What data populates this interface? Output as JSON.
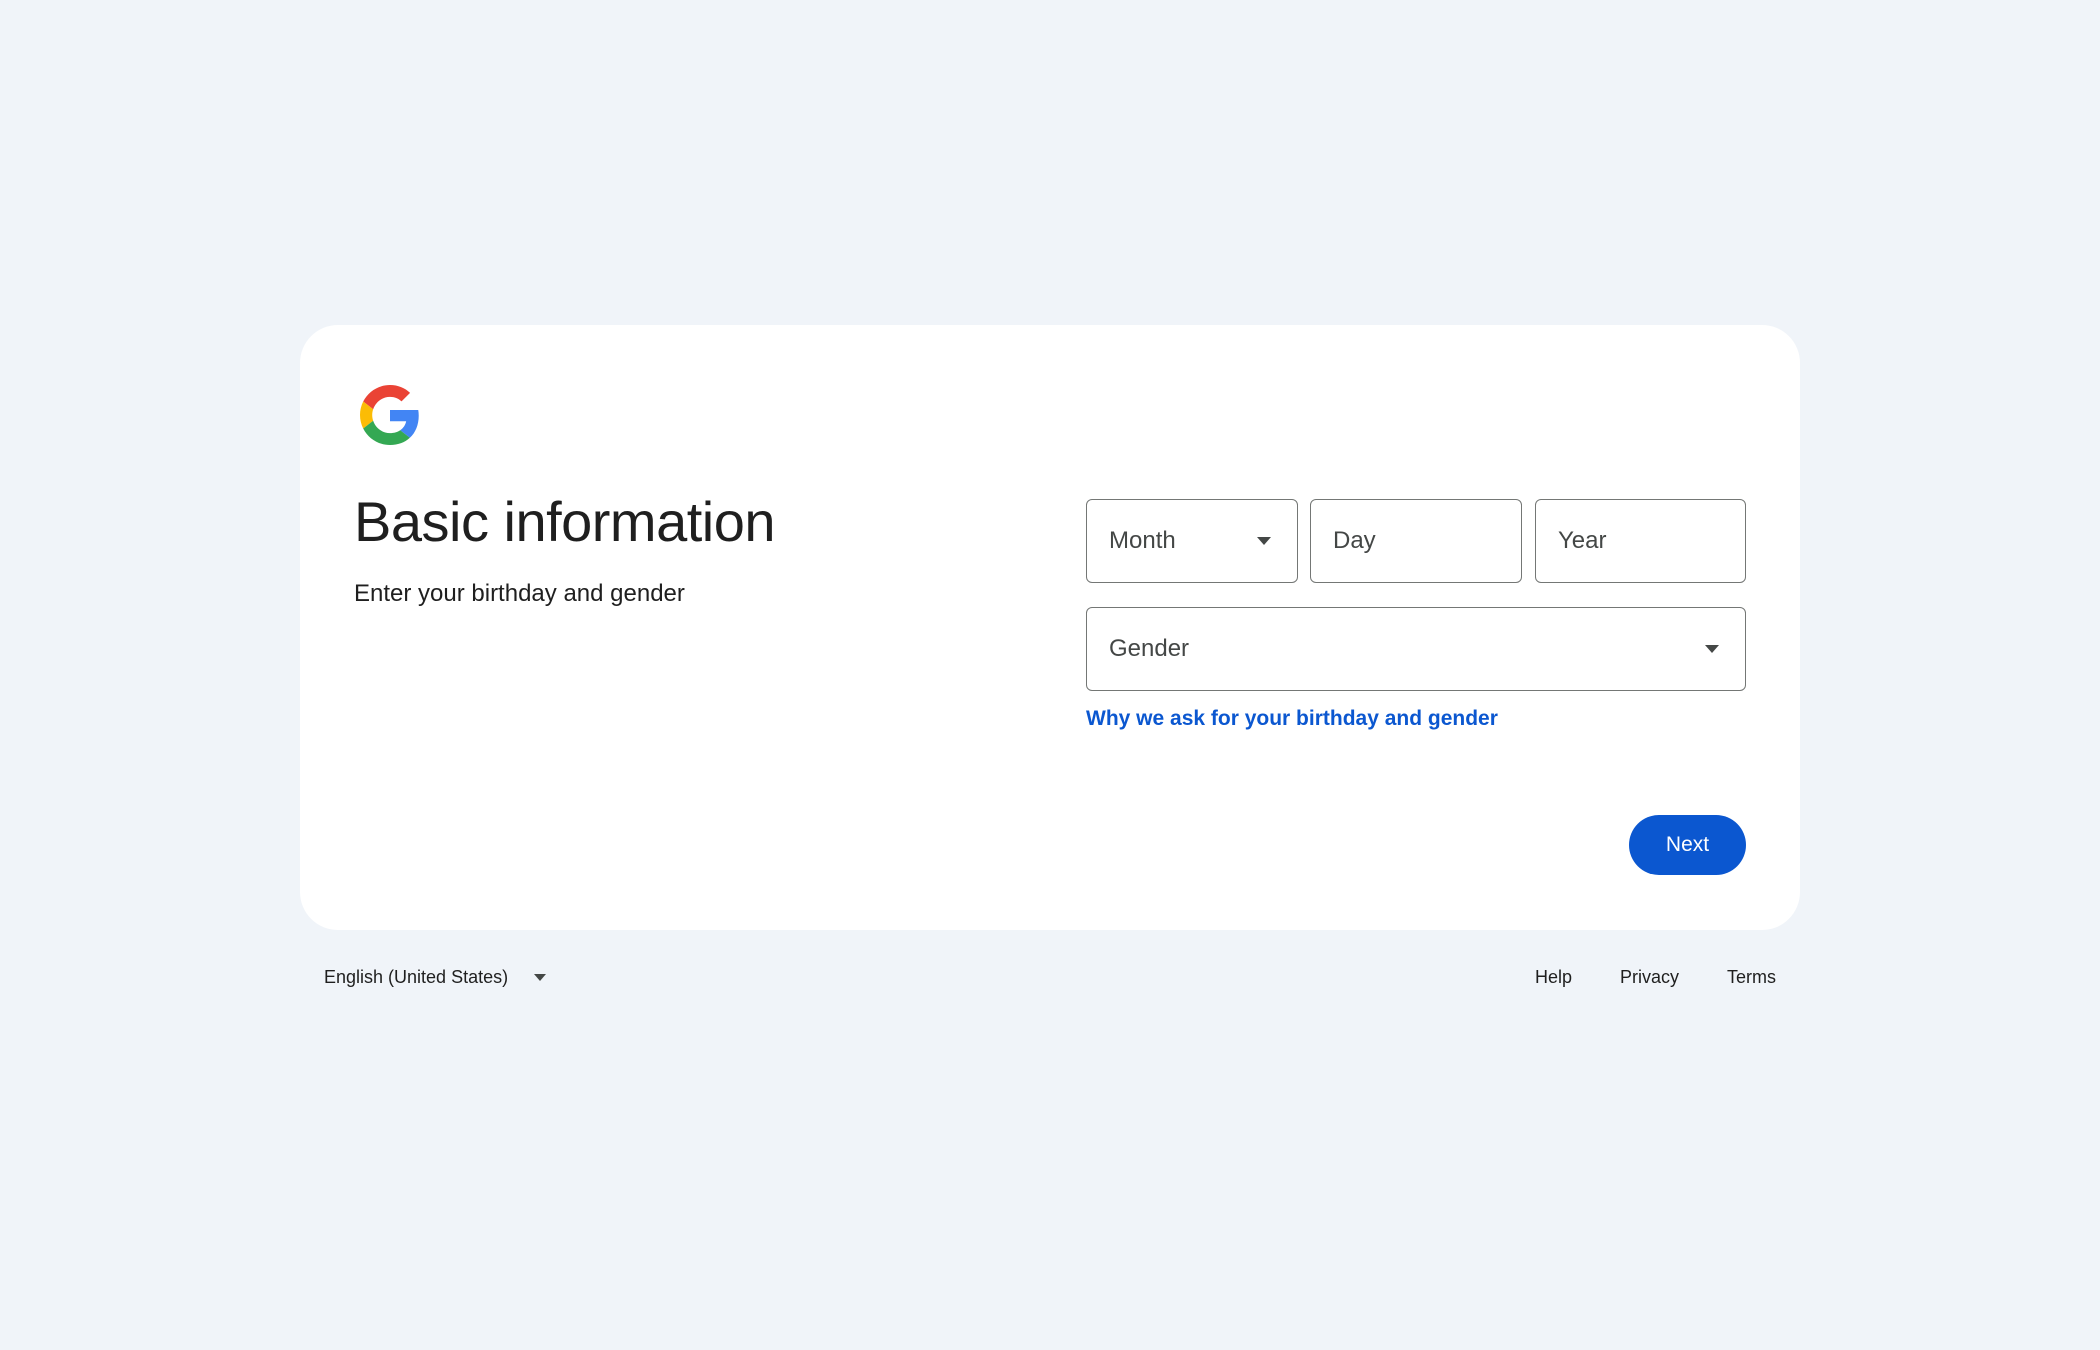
{
  "logo": {
    "icon": "google-g-logo",
    "colors": {
      "blue": "#4285F4",
      "red": "#EA4335",
      "yellow": "#FBBC05",
      "green": "#34A853"
    }
  },
  "header": {
    "title": "Basic information",
    "subtitle": "Enter your birthday and gender"
  },
  "form": {
    "month": {
      "placeholder": "Month",
      "icon": "chevron-down-icon"
    },
    "day": {
      "placeholder": "Day"
    },
    "year": {
      "placeholder": "Year"
    },
    "gender": {
      "placeholder": "Gender",
      "icon": "chevron-down-icon"
    },
    "why_link": "Why we ask for your birthday and gender"
  },
  "actions": {
    "next_label": "Next"
  },
  "footer": {
    "language": "English (United States)",
    "links": [
      "Help",
      "Privacy",
      "Terms"
    ]
  },
  "colors": {
    "background": "#f0f4f9",
    "card": "#ffffff",
    "accent": "#0b57d0",
    "text": "#1f1f1f",
    "field_border": "#747775"
  }
}
